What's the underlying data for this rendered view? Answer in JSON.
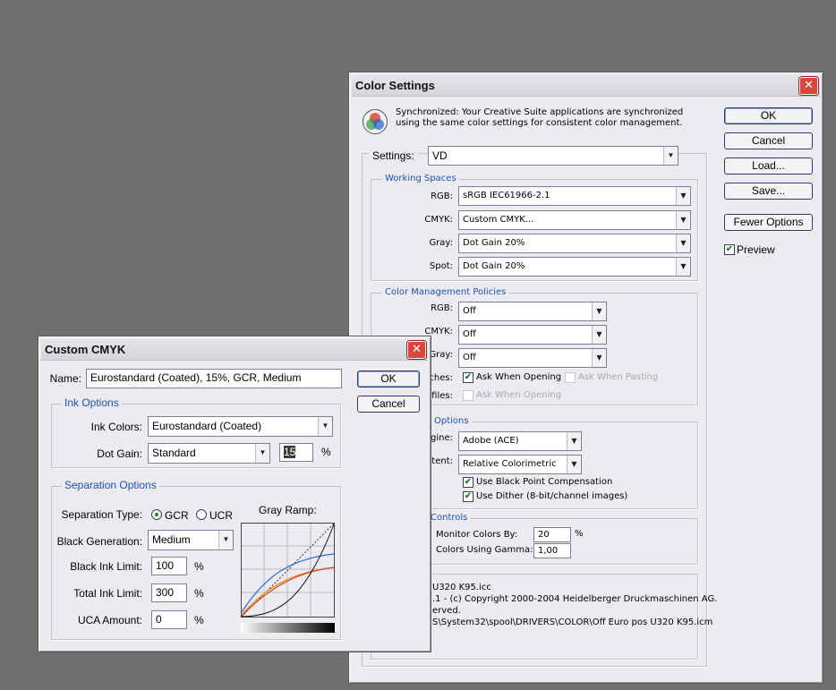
{
  "colorSettings": {
    "title": "Color Settings",
    "sync_line1": "Synchronized: Your Creative Suite applications are synchronized",
    "sync_line2": "using the same color settings for consistent color management.",
    "settings_label": "Settings:",
    "settings_value": "VD",
    "buttons": {
      "ok": "OK",
      "cancel": "Cancel",
      "load": "Load...",
      "save": "Save...",
      "fewer": "Fewer Options"
    },
    "preview_label": "Preview",
    "working_spaces": {
      "title": "Working Spaces",
      "rgb_label": "RGB:",
      "rgb_value": "sRGB IEC61966-2.1",
      "cmyk_label": "CMYK:",
      "cmyk_value": "Custom CMYK...",
      "gray_label": "Gray:",
      "gray_value": "Dot Gain 20%",
      "spot_label": "Spot:",
      "spot_value": "Dot Gain 20%"
    },
    "policies": {
      "title": "Color Management Policies",
      "rgb_label": "RGB:",
      "rgb_value": "Off",
      "cmyk_label": "CMYK:",
      "cmyk_value": "Off",
      "gray_label": "Gray:",
      "gray_value": "Off",
      "mismatch_label": "ches:",
      "ask_opening": "Ask When Opening",
      "ask_pasting": "Ask When Pasting",
      "missing_label": "ofiles:",
      "ask_opening2": "Ask When Opening"
    },
    "conversion": {
      "title": "Options",
      "engine_label": "gine:",
      "engine_value": "Adobe (ACE)",
      "intent_label": "ntent:",
      "intent_value": "Relative Colorimetric",
      "bpc": "Use Black Point Compensation",
      "dither": "Use Dither (8-bit/channel images)"
    },
    "advanced": {
      "title": "Controls",
      "monitor_label": "Monitor Colors By:",
      "monitor_value": "20",
      "monitor_unit": "%",
      "gamma_label": "Colors Using Gamma:",
      "gamma_value": "1,00"
    },
    "description": {
      "line1": "U320 K95.icc",
      ".line2": "",
      "line2": ".1 - (c) Copyright 2000-2004 Heidelberger Druckmaschinen AG.",
      "line3": "erved.",
      "line4": "S\\System32\\spool\\DRIVERS\\COLOR\\Off Euro pos U320 K95.icm"
    }
  },
  "customCMYK": {
    "title": "Custom CMYK",
    "name_label": "Name:",
    "name_value": "Eurostandard (Coated), 15%, GCR, Medium",
    "ok": "OK",
    "cancel": "Cancel",
    "ink_options": {
      "title": "Ink Options",
      "ink_colors_label": "Ink Colors:",
      "ink_colors_value": "Eurostandard (Coated)",
      "dot_gain_label": "Dot Gain:",
      "dot_gain_value": "Standard",
      "dot_gain_percent": "15",
      "percent": "%"
    },
    "separation": {
      "title": "Separation Options",
      "type_label": "Separation Type:",
      "gcr": "GCR",
      "ucr": "UCR",
      "gray_ramp_label": "Gray Ramp:",
      "black_gen_label": "Black Generation:",
      "black_gen_value": "Medium",
      "black_ink_label": "Black Ink Limit:",
      "black_ink_value": "100",
      "total_ink_label": "Total Ink Limit:",
      "total_ink_value": "300",
      "uca_label": "UCA Amount:",
      "uca_value": "0",
      "percent": "%"
    }
  },
  "colors": {
    "background": "#6f6f6f",
    "dialog": "#ececf0",
    "group_title": "#1f4fb8",
    "close": "#d9463c"
  }
}
